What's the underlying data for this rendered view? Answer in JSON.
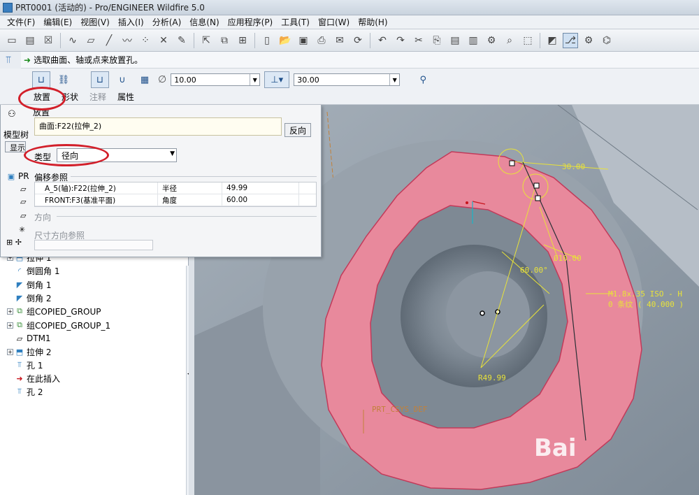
{
  "window": {
    "title": "PRT0001 (活动的) - Pro/ENGINEER Wildfire 5.0"
  },
  "menu": [
    "文件(F)",
    "编辑(E)",
    "视图(V)",
    "插入(I)",
    "分析(A)",
    "信息(N)",
    "应用程序(P)",
    "工具(T)",
    "窗口(W)",
    "帮助(H)"
  ],
  "toolbar_icons": [
    "new-icon",
    "open-icon",
    "close-window-icon",
    "sketch-curve-icon",
    "plane-icon",
    "axis-icon",
    "curve-icon",
    "point-icon",
    "csys-icon",
    "analysis-icon"
  ],
  "prompt": {
    "text": "选取曲面、轴或点来放置孔。"
  },
  "dashboard": {
    "diameter_value": "10.00",
    "depth_value": "30.00",
    "tabs": [
      {
        "label": "放置",
        "active": true
      },
      {
        "label": "形状",
        "active": false
      },
      {
        "label": "注释",
        "active": false
      },
      {
        "label": "属性",
        "active": false
      }
    ]
  },
  "placement_panel": {
    "section_label": "放置",
    "placement_ref": "曲面:F22(拉伸_2)",
    "flip_button": "反向",
    "type_label": "类型",
    "type_value": "径向",
    "offset_refs_label": "偏移参照",
    "offset_refs": [
      {
        "ref": "A_5(轴):F22(拉伸_2)",
        "type": "半径",
        "value": "49.99"
      },
      {
        "ref": "FRONT:F3(基准平面)",
        "type": "角度",
        "value": "60.00"
      }
    ],
    "direction_label": "方向",
    "dim_dir_ref_label": "尺寸方向参照"
  },
  "model_tree": {
    "header_label": "模型树",
    "show_button": "显示",
    "root": "PR",
    "items": [
      {
        "label": "拉伸 1",
        "icon": "extrude-icon",
        "expandable": true
      },
      {
        "label": "倒圆角 1",
        "icon": "round-icon",
        "expandable": false
      },
      {
        "label": "倒角 1",
        "icon": "chamfer-icon",
        "expandable": false
      },
      {
        "label": "倒角 2",
        "icon": "chamfer-icon",
        "expandable": false
      },
      {
        "label": "组COPIED_GROUP",
        "icon": "group-icon",
        "expandable": true
      },
      {
        "label": "组COPIED_GROUP_1",
        "icon": "group-icon",
        "expandable": true
      },
      {
        "label": "DTM1",
        "icon": "datum-plane-icon",
        "expandable": false
      },
      {
        "label": "拉伸 2",
        "icon": "extrude-icon",
        "expandable": true
      },
      {
        "label": "孔 1",
        "icon": "hole-icon",
        "expandable": false
      },
      {
        "label": "在此插入",
        "icon": "insert-here-icon",
        "expandable": false
      },
      {
        "label": "孔 2",
        "icon": "hole-icon",
        "expandable": false
      }
    ]
  },
  "graphics": {
    "dim_angle_top": "30.00",
    "dim_angle": "60.00°",
    "dim_diameter": "Ø10.00",
    "dim_radius": "R49.99",
    "thread_note_line1": "M1.8x.35 ISO - H",
    "thread_note_line2": "0 条纹 ( 40.000 )",
    "csys_label": "PRT_CSYS_DEF",
    "watermark": "Bai"
  },
  "colors": {
    "ring_fill": "#e8899c",
    "dim_color": "#e8e23a",
    "annotation_red": "#d21f2a"
  }
}
